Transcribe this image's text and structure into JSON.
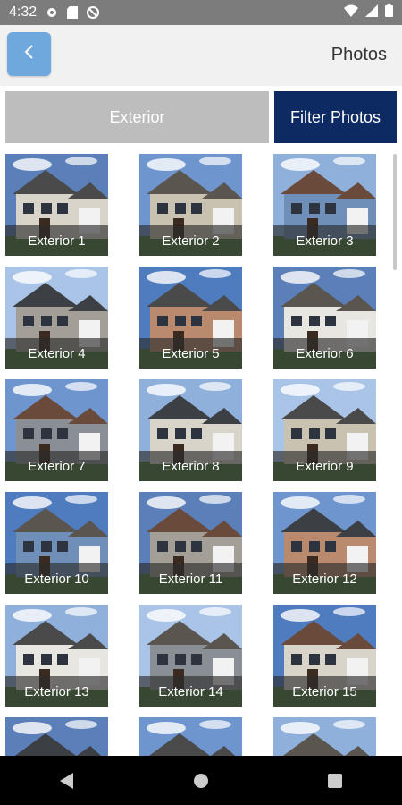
{
  "status": {
    "time": "4:32"
  },
  "header": {
    "title": "Photos"
  },
  "filters": {
    "exterior_label": "Exterior",
    "filter_label": "Filter Photos"
  },
  "colors": {
    "accent": "#0d2a63",
    "back": "#6fa8dc"
  },
  "photos": [
    {
      "label": "Exterior 1"
    },
    {
      "label": "Exterior 2"
    },
    {
      "label": "Exterior 3"
    },
    {
      "label": "Exterior 4"
    },
    {
      "label": "Exterior 5"
    },
    {
      "label": "Exterior 6"
    },
    {
      "label": "Exterior 7"
    },
    {
      "label": "Exterior 8"
    },
    {
      "label": "Exterior 9"
    },
    {
      "label": "Exterior 10"
    },
    {
      "label": "Exterior 11"
    },
    {
      "label": "Exterior 12"
    },
    {
      "label": "Exterior 13"
    },
    {
      "label": "Exterior 14"
    },
    {
      "label": "Exterior 15"
    },
    {
      "label": ""
    },
    {
      "label": ""
    },
    {
      "label": ""
    }
  ]
}
